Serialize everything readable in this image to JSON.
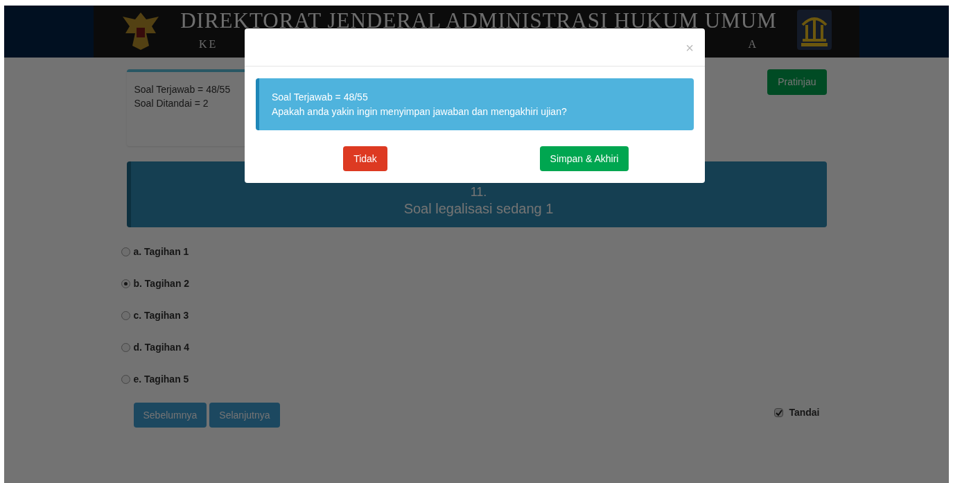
{
  "header": {
    "title": "DIREKTORAT JENDERAL ADMINISTRASI HUKUM UMUM",
    "subtitle_start": "KE",
    "subtitle_end": "A"
  },
  "summary": {
    "lines": [
      "Soal Terjawab = 48/55",
      "Soal Ditandai = 2"
    ]
  },
  "preview_button": "Pratinjau",
  "question": {
    "number": "11.",
    "text": "Soal legalisasi sedang 1"
  },
  "options": [
    {
      "label": "a. Tagihan 1",
      "selected": false
    },
    {
      "label": "b. Tagihan 2",
      "selected": true
    },
    {
      "label": "c. Tagihan 3",
      "selected": false
    },
    {
      "label": "d. Tagihan 4",
      "selected": false
    },
    {
      "label": "e. Tagihan 5",
      "selected": false
    }
  ],
  "nav_buttons": [
    "Sebelumnya",
    "Selanjutnya"
  ],
  "mark": {
    "label": "Tandai",
    "checked": true
  },
  "modal": {
    "close": "×",
    "message_lines": [
      "Soal Terjawab = 48/55",
      "Apakah anda yakin ingin menyimpan jawaban dan mengakhiri ujian?"
    ],
    "buttons": [
      {
        "label": "Tidak",
        "kind": "danger"
      },
      {
        "label": "Simpan & Akhiri",
        "kind": "success"
      }
    ]
  }
}
